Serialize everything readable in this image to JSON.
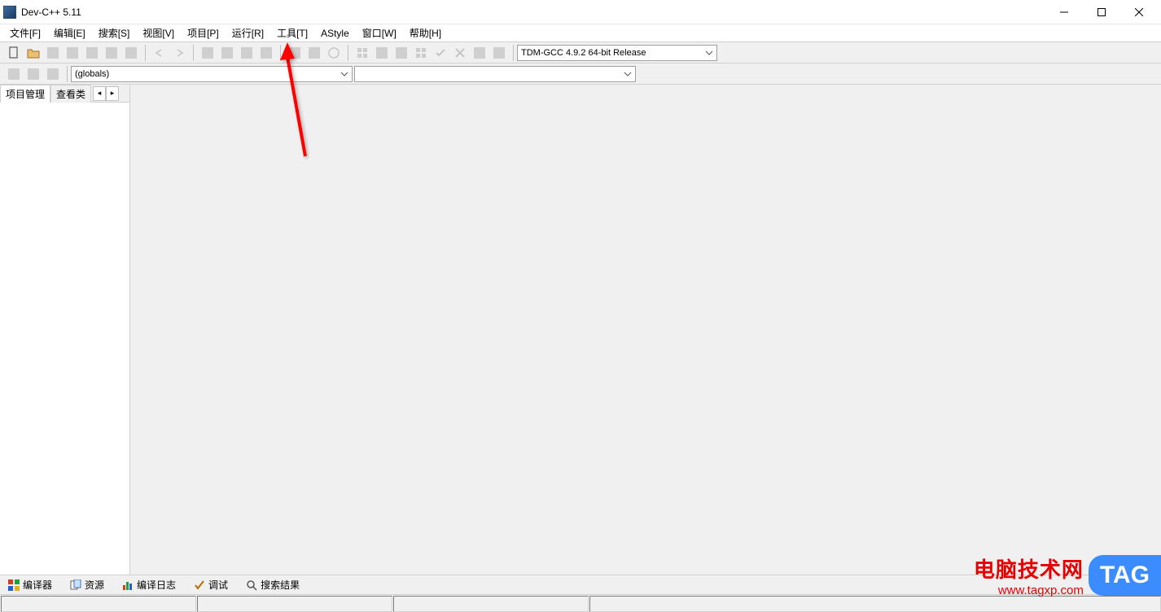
{
  "title": "Dev-C++ 5.11",
  "menu": {
    "file": "文件[F]",
    "edit": "编辑[E]",
    "search": "搜索[S]",
    "view": "视图[V]",
    "project": "项目[P]",
    "run": "运行[R]",
    "tools": "工具[T]",
    "astyle": "AStyle",
    "window": "窗口[W]",
    "help": "帮助[H]"
  },
  "compiler_combo": "TDM-GCC 4.9.2 64-bit Release",
  "globals_combo": "(globals)",
  "members_combo": "",
  "side_tabs": {
    "project": "项目管理",
    "classes": "查看类"
  },
  "bottom_tabs": {
    "compiler": "编译器",
    "resources": "资源",
    "compile_log": "编译日志",
    "debug": "调试",
    "search_results": "搜索结果"
  },
  "watermark": {
    "cn": "电脑技术网",
    "url": "www.tagxp.com",
    "tag": "TAG"
  }
}
